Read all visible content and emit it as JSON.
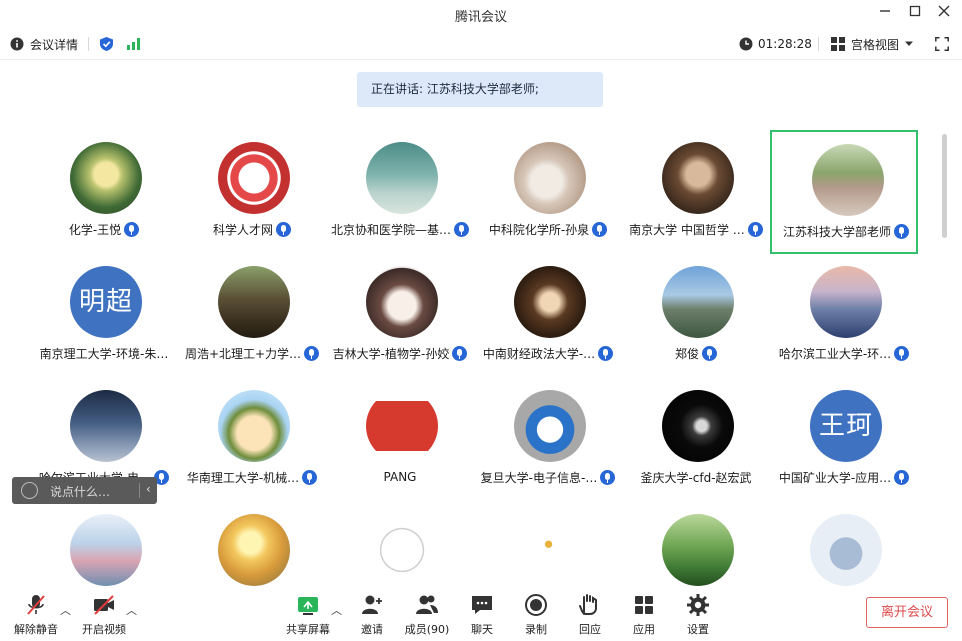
{
  "window": {
    "title": "腾讯会议"
  },
  "infobar": {
    "meeting_details": "会议详情",
    "timer": "01:28:28",
    "view_mode": "宫格视图"
  },
  "speaking": {
    "text": "正在讲话: 江苏科技大学部老师;"
  },
  "participants": [
    {
      "name": "化学-王悦",
      "mic": true,
      "avatar": "flower-photo"
    },
    {
      "name": "科学人才网",
      "mic": true,
      "avatar": "emblem-logo"
    },
    {
      "name": "北京协和医学院—基…",
      "mic": true,
      "avatar": "beach-photo"
    },
    {
      "name": "中科院化学所-孙泉",
      "mic": true,
      "avatar": "dog-photo"
    },
    {
      "name": "南京大学 中国哲学 …",
      "mic": true,
      "avatar": "painting-photo"
    },
    {
      "name": "江苏科技大学部老师",
      "mic": true,
      "avatar": "garden-photo",
      "active": true
    },
    {
      "name": "南京理工大学-环境-朱…",
      "mic": false,
      "avatar_text": "明超"
    },
    {
      "name": "周浩+北理工+力学…",
      "mic": true,
      "avatar": "forest-photo"
    },
    {
      "name": "吉林大学-植物学-孙姣",
      "mic": true,
      "avatar": "anime-girl"
    },
    {
      "name": "中南财经政法大学-…",
      "mic": true,
      "avatar": "anime-character"
    },
    {
      "name": "郑俊",
      "mic": true,
      "avatar": "gate-photo"
    },
    {
      "name": "哈尔滨工业大学-环…",
      "mic": true,
      "avatar": "lake-photo"
    },
    {
      "name": "哈尔滨工业大学-电…",
      "mic": true,
      "avatar": "crowd-photo"
    },
    {
      "name": "华南理工大学-机械…",
      "mic": true,
      "avatar": "cartoon-boy"
    },
    {
      "name": "PANG",
      "mic": false,
      "avatar": "red-card"
    },
    {
      "name": "复旦大学-电子信息-…",
      "mic": true,
      "avatar": "doraemon"
    },
    {
      "name": "釜庆大学-cfd-赵宏武",
      "mic": false,
      "avatar": "astronaut"
    },
    {
      "name": "中国矿业大学-应用…",
      "mic": true,
      "avatar_text": "王珂"
    },
    {
      "name": "",
      "mic": false,
      "avatar": "blossom-photo"
    },
    {
      "name": "",
      "mic": false,
      "avatar": "sunflower-photo"
    },
    {
      "name": "",
      "mic": false,
      "avatar": "sketch"
    },
    {
      "name": "",
      "mic": false,
      "avatar": "small-doodle"
    },
    {
      "name": "",
      "mic": false,
      "avatar": "grass-photo"
    },
    {
      "name": "",
      "mic": false,
      "avatar": "elephant"
    }
  ],
  "chat": {
    "placeholder": "说点什么…"
  },
  "toolbar": {
    "unmute": "解除静音",
    "start_video": "开启视频",
    "share_screen": "共享屏幕",
    "invite": "邀请",
    "members": "成员(90)",
    "chat": "聊天",
    "record": "录制",
    "react": "回应",
    "apps": "应用",
    "settings": "设置",
    "leave": "离开会议"
  },
  "colors": {
    "accent": "#2766d6",
    "active_border": "#33c06a",
    "leave": "#e04b4b"
  }
}
